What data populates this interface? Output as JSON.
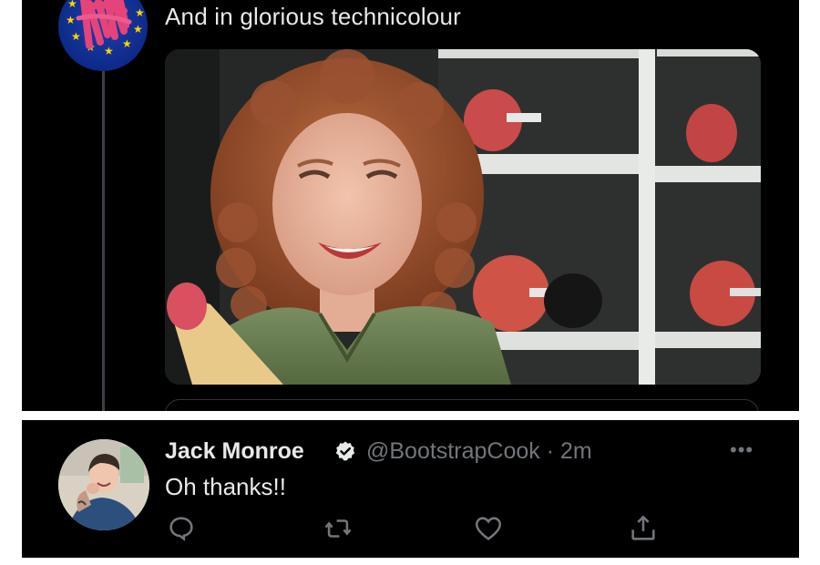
{
  "top_tweet": {
    "text": "And in glorious technicolour",
    "avatar_icon": "eu-flag-avatar-icon",
    "media_alt": "colorized-photo-of-smiling-woman-with-curly-red-hair"
  },
  "reply_tweet": {
    "name": "Jack Monroe",
    "handle_time": "@BootstrapCook · 2m",
    "text": "Oh thanks!!",
    "verified_icon": "verified-badge-icon",
    "actions": [
      "reply-icon",
      "retweet-icon",
      "like-icon",
      "share-icon"
    ],
    "more_icon": "more-options-icon"
  },
  "colors": {
    "background": "#000000",
    "text": "#e7e9ea",
    "muted": "#71767b",
    "divider": "#2f3336"
  }
}
